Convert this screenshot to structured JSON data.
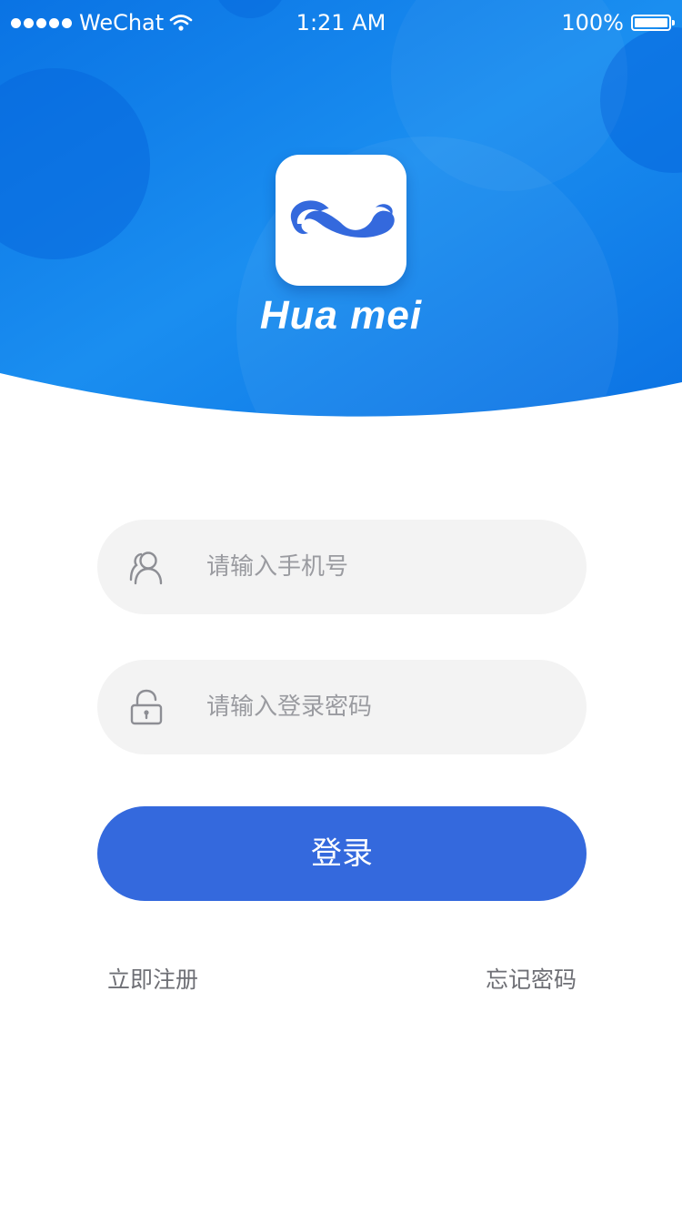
{
  "status_bar": {
    "carrier": "WeChat",
    "time": "1:21 AM",
    "battery": "100%"
  },
  "brand": {
    "name": "Hua mei",
    "primary_color": "#0d7fe6",
    "logo_color": "#3469dd"
  },
  "form": {
    "phone_placeholder": "请输入手机号",
    "password_placeholder": "请输入登录密码",
    "login_label": "登录"
  },
  "links": {
    "register": "立即注册",
    "forgot_password": "忘记密码"
  },
  "colors": {
    "button": "#3469dd",
    "field_bg": "#f3f3f3",
    "placeholder": "#9a9ba0",
    "link_text": "#6e6f75"
  },
  "icons": {
    "phone_field": "user-icon",
    "password_field": "lock-icon",
    "status_wifi": "wifi-icon",
    "status_battery": "battery-icon"
  }
}
